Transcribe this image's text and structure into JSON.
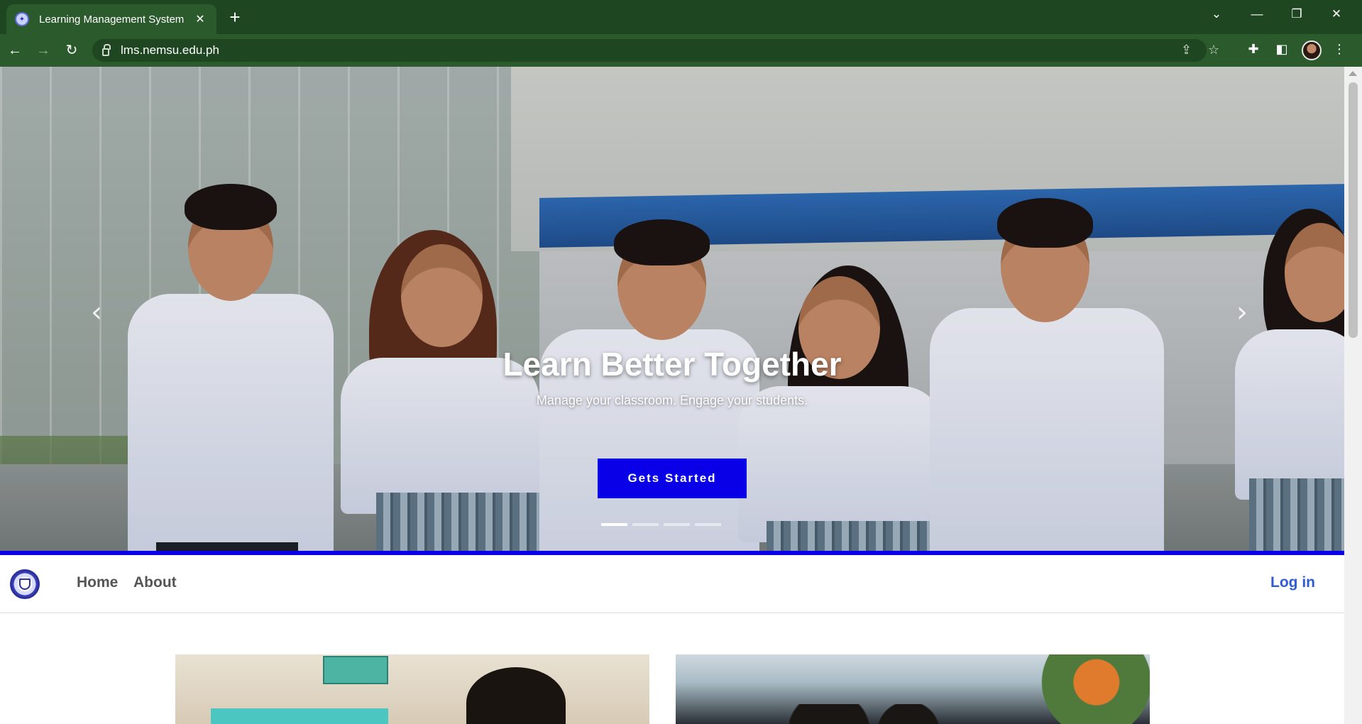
{
  "browser": {
    "tab_title": "Learning Management System",
    "url": "lms.nemsu.edu.ph"
  },
  "hero": {
    "title": "Learn Better Together",
    "subtitle": "Manage your classroom. Engage your students.",
    "cta_label": "Gets Started",
    "slide_count": 4,
    "active_slide": 1,
    "accent_color": "#0a00e8"
  },
  "nav": {
    "links": [
      "Home",
      "About"
    ],
    "login_label": "Log in",
    "login_color": "#2f5bd4"
  }
}
